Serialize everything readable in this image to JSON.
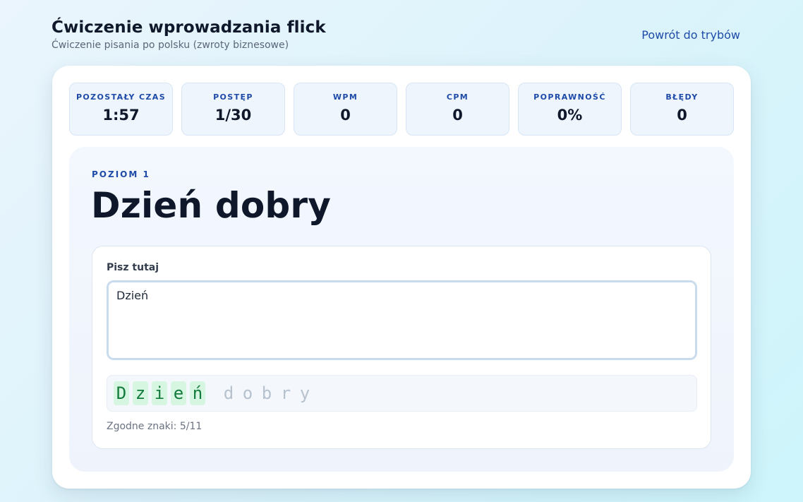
{
  "header": {
    "title": "Ćwiczenie wprowadzania flick",
    "subtitle": "Ćwiczenie pisania po polsku (zwroty biznesowe)",
    "back_link": "Powrót do trybów"
  },
  "stats": [
    {
      "label": "POZOSTAŁY CZAS",
      "value": "1:57"
    },
    {
      "label": "POSTĘP",
      "value": "1/30"
    },
    {
      "label": "WPM",
      "value": "0"
    },
    {
      "label": "CPM",
      "value": "0"
    },
    {
      "label": "POPRAWNOŚĆ",
      "value": "0%"
    },
    {
      "label": "BŁĘDY",
      "value": "0"
    }
  ],
  "exercise": {
    "level": "POZIOM 1",
    "prompt": "Dzień dobry",
    "input_label": "Pisz tutaj",
    "input_value": "Dzień",
    "chars": [
      {
        "c": "D",
        "state": "ok"
      },
      {
        "c": "z",
        "state": "ok"
      },
      {
        "c": "i",
        "state": "ok"
      },
      {
        "c": "e",
        "state": "ok"
      },
      {
        "c": "ń",
        "state": "ok"
      },
      {
        "c": " ",
        "state": "space"
      },
      {
        "c": "d",
        "state": "pending"
      },
      {
        "c": "o",
        "state": "pending"
      },
      {
        "c": "b",
        "state": "pending"
      },
      {
        "c": "r",
        "state": "pending"
      },
      {
        "c": "y",
        "state": "pending"
      }
    ],
    "match_count": "Zgodne znaki: 5/11"
  },
  "colors": {
    "accent": "#1e4ba8",
    "correct_bg": "#d6f6e2",
    "correct_text": "#127a3c",
    "pending_text": "#b7c2cf"
  }
}
